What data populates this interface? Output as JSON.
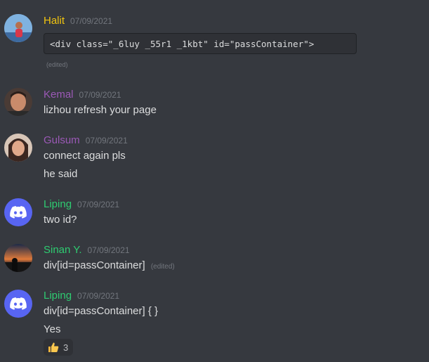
{
  "colors": {
    "background": "#36393f",
    "halit": "#f1c40f",
    "kemal": "#9b59b6",
    "gulsum": "#9b59b6",
    "green": "#2ecc71",
    "discord_blurple": "#5865f2"
  },
  "messages": [
    {
      "author": "Halit",
      "timestamp": "07/09/2021",
      "code": "<div class=\"_6luy _55r1 _1kbt\" id=\"passContainer\">",
      "edited": "(edited)"
    },
    {
      "author": "Kemal",
      "timestamp": "07/09/2021",
      "lines": [
        "lizhou refresh your page"
      ]
    },
    {
      "author": "Gulsum",
      "timestamp": "07/09/2021",
      "lines": [
        "connect again pls",
        "he said"
      ]
    },
    {
      "author": "Liping",
      "timestamp": "07/09/2021",
      "lines": [
        "two id?"
      ]
    },
    {
      "author": "Sinan Y.",
      "timestamp": "07/09/2021",
      "lines": [
        "div[id=passContainer]"
      ],
      "edited": "(edited)"
    },
    {
      "author": "Liping",
      "timestamp": "07/09/2021",
      "lines": [
        "div[id=passContainer] { }",
        "Yes"
      ],
      "reaction": {
        "emoji": "thumbs-up-icon",
        "count": "3"
      }
    }
  ]
}
